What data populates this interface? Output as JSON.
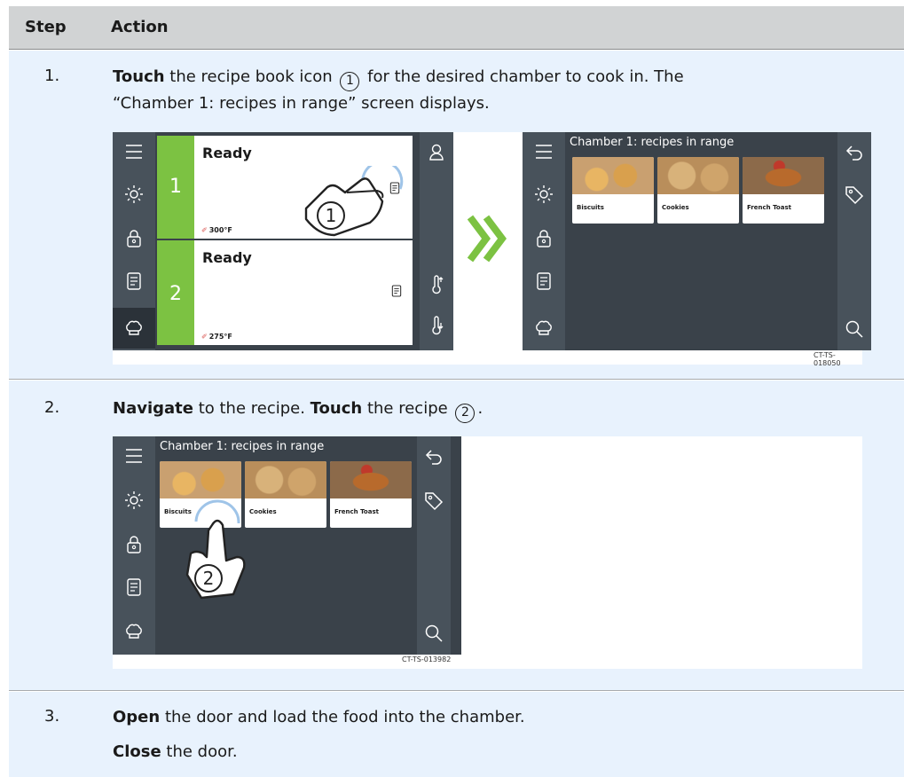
{
  "header": {
    "step": "Step",
    "action": "Action"
  },
  "steps": [
    {
      "num": "1.",
      "line1_bold": "Touch",
      "line1_rest": " the recipe book icon",
      "line1_marker": "1",
      "line1_after": " for the desired chamber to cook in. The",
      "line2": "“Chamber 1: recipes in range” screen displays."
    },
    {
      "num": "2.",
      "bold1": "Navigate",
      "mid": " to the recipe. ",
      "bold2": "Touch",
      "rest": " the recipe",
      "marker": "2",
      "end": "."
    },
    {
      "num": "3.",
      "bold1": "Open",
      "rest1": " the door and load the food into the chamber.",
      "bold2": "Close",
      "rest2": " the door."
    }
  ],
  "figure1": {
    "code": "CT-TS-018050",
    "chambers": [
      {
        "num": "1",
        "status": "Ready",
        "temp": "300°F"
      },
      {
        "num": "2",
        "status": "Ready",
        "temp": "275°F"
      }
    ],
    "callout": "1"
  },
  "recipes_screen": {
    "title": "Chamber 1: recipes in range",
    "recipes": [
      "Biscuits",
      "Cookies",
      "French Toast"
    ]
  },
  "figure2": {
    "code": "CT-TS-013982",
    "callout": "2"
  },
  "colors": {
    "ready_green": "#7cc242",
    "chevron_green": "#7cc242",
    "nav_dark": "#48525b",
    "touch_ring": "#9fc4e8"
  },
  "icons": [
    "menu-icon",
    "sun-icon",
    "lock-icon",
    "recipe-book-icon",
    "chef-hat-icon",
    "back-arrow-icon",
    "tag-icon",
    "search-icon",
    "probe-thermometer-icon",
    "thermometer-icon",
    "touch-hand-icon",
    "double-chevron-icon"
  ]
}
